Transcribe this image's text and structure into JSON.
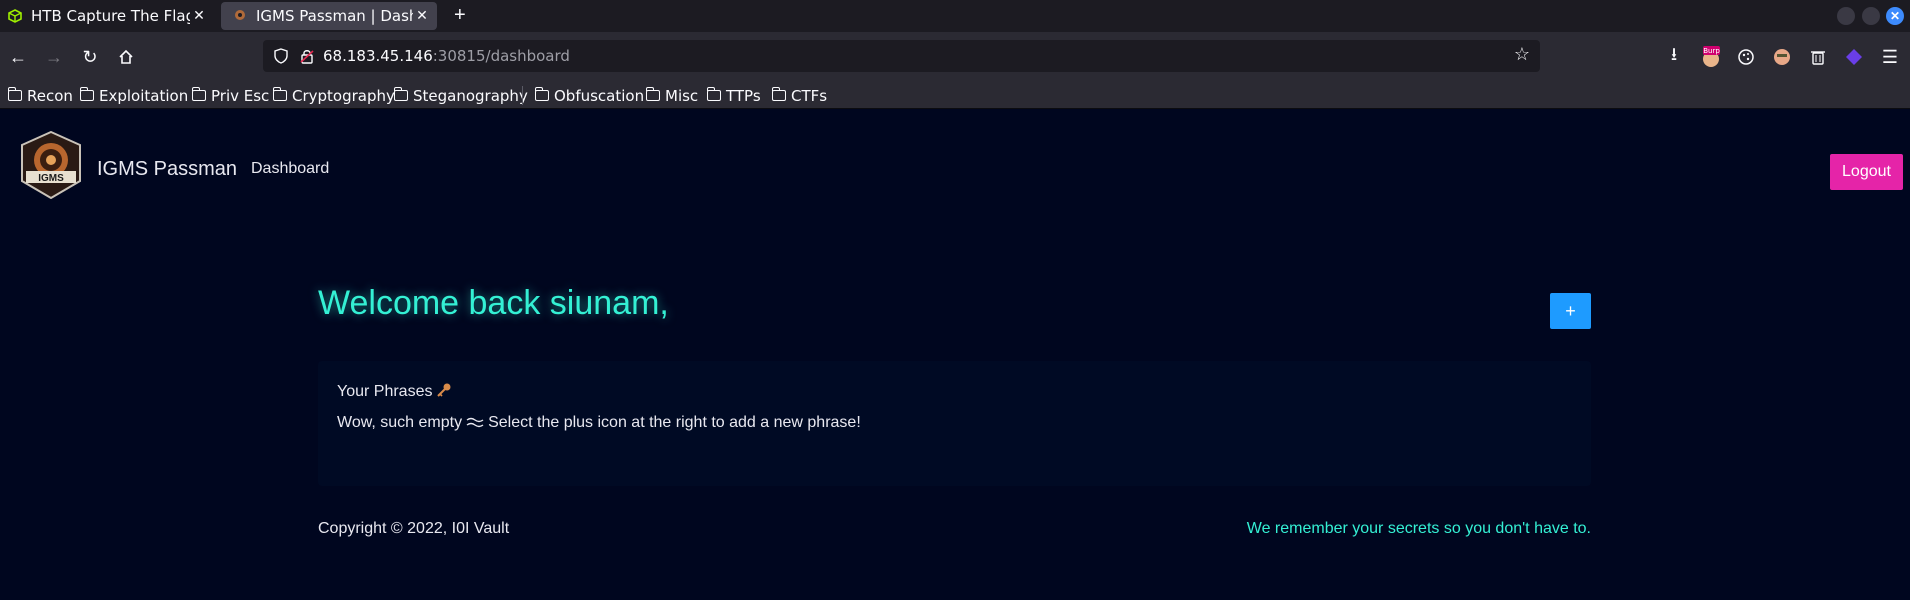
{
  "browser": {
    "tabs": [
      {
        "title": "HTB Capture The Flag Pla",
        "icon": "htb-cube-icon"
      },
      {
        "title": "IGMS Passman | Dashboar",
        "icon": "igms-favicon"
      }
    ],
    "new_tab": "+",
    "url_host": "68.183.45.146",
    "url_rest": ":30815/dashboard",
    "burp_badge": "Burp",
    "bookmarks": [
      "Recon",
      "Exploitation",
      "Priv Esc",
      "Cryptography",
      "Steganography",
      "Obfuscation",
      "Misc",
      "TTPs",
      "CTFs"
    ]
  },
  "page": {
    "logo_text": "IGMS",
    "brand": "IGMS Passman",
    "nav_link": "Dashboard",
    "logout_label": "Logout",
    "welcome": "Welcome back siunam,",
    "add_label": "+",
    "phrases_title": "Your Phrases",
    "empty_text_1": "Wow, such empty",
    "empty_text_2": "Select the plus icon at the right to add a new phrase!",
    "copyright": "Copyright © 2022, I0I Vault",
    "tagline": "We remember your secrets so you don't have to."
  },
  "colors": {
    "background": "#00061f",
    "accent_teal": "#34f0d4",
    "logout": "#e524a8",
    "add_button": "#1e9bff"
  }
}
